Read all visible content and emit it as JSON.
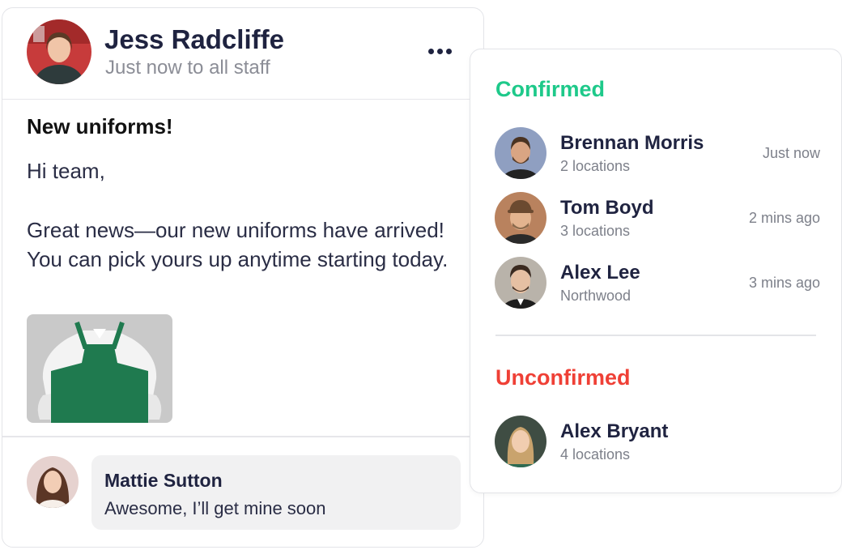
{
  "post": {
    "author": "Jess Radcliffe",
    "meta": "Just now to all staff",
    "more_icon": "ellipsis-icon",
    "title": "New uniforms!",
    "greeting": "Hi team,",
    "body": "Great news—our new uniforms have arrived! You can pick yours up anytime starting today.",
    "image_subject": "green apron over white shirt",
    "comment": {
      "author": "Mattie Sutton",
      "text": "Awesome, I’ll get mine soon"
    }
  },
  "panel": {
    "confirmed_title": "Confirmed",
    "confirmed": [
      {
        "name": "Brennan Morris",
        "sub": "2 locations",
        "time": "Just now"
      },
      {
        "name": "Tom Boyd",
        "sub": "3 locations",
        "time": "2 mins ago"
      },
      {
        "name": "Alex Lee",
        "sub": "Northwood",
        "time": "3 mins ago"
      }
    ],
    "unconfirmed_title": "Unconfirmed",
    "unconfirmed": [
      {
        "name": "Alex Bryant",
        "sub": "4 locations"
      }
    ]
  },
  "colors": {
    "confirmed": "#1ec98a",
    "unconfirmed": "#ef4036",
    "text_primary": "#1f2340",
    "apron": "#1f7a4f"
  }
}
